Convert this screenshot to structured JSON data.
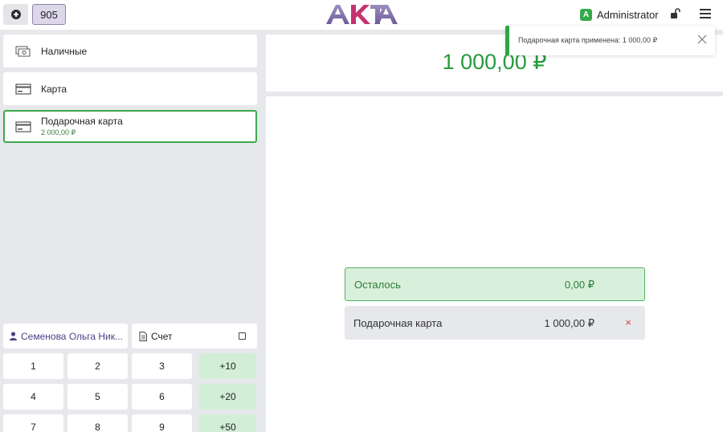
{
  "header": {
    "add_icon": "plus-circle-icon",
    "order_number": "905",
    "logo_text": "AKTA",
    "user": {
      "avatar_letter": "A",
      "name": "Administrator",
      "avatar_color": "#35a94b"
    }
  },
  "payment_methods": [
    {
      "label": "Наличные",
      "icon": "cash-icon"
    },
    {
      "label": "Карта",
      "icon": "card-icon"
    },
    {
      "label": "Подарочная карта",
      "balance": "2 000,00 ₽",
      "icon": "gift-card-icon",
      "selected": true
    }
  ],
  "customer": {
    "name": "Семенова Ольга Ник..."
  },
  "invoice": {
    "label": "Счет",
    "checked": false
  },
  "keypad": {
    "keys": [
      "1",
      "2",
      "3",
      "4",
      "5",
      "6",
      "7",
      "8",
      "9"
    ],
    "add_keys": [
      "+10",
      "+20",
      "+50"
    ]
  },
  "total": {
    "amount": "1 000,00 ₽"
  },
  "summary": {
    "remaining_label": "Осталось",
    "remaining_value": "0,00 ₽",
    "applied_label": "Подарочная карта",
    "applied_value": "1 000,00 ₽",
    "remove_glyph": "×"
  },
  "toast": {
    "message": "Подарочная карта применена: 1 000,00 ₽"
  },
  "colors": {
    "accent_green": "#3fa84f",
    "brand_purple": "#8d84ad",
    "danger": "#d93d3d"
  }
}
